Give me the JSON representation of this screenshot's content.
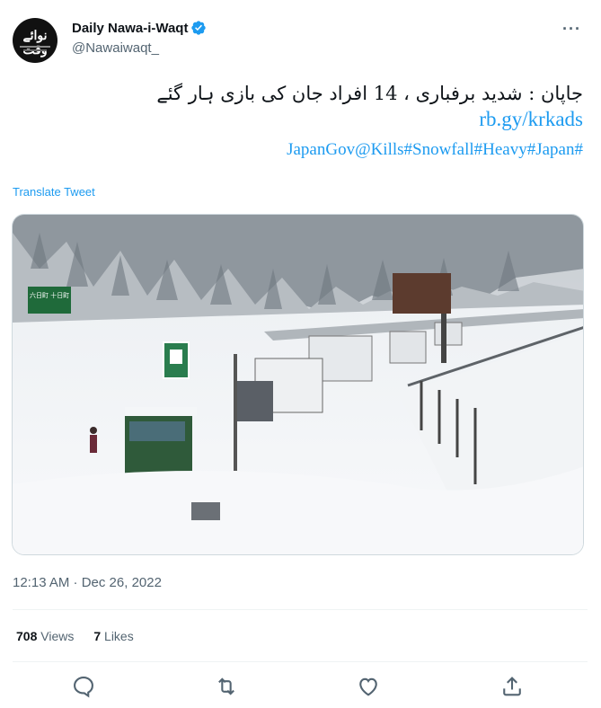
{
  "account": {
    "display_name": "Daily Nawa-i-Waqt",
    "handle": "@Nawaiwaqt_",
    "avatar_text": "نوائے وقت",
    "verified_icon": "verified-badge-icon",
    "verified_color": "#1d9bf0"
  },
  "tweet": {
    "urdu_text": "جاپان : شدید برفباری ، 14 افراد جان کی بازی ہار گئے",
    "link": "rb.gy/krkads",
    "hashtags": "JapanGov@Kills#Snowfall#Heavy#Japan#"
  },
  "translate_label": "Translate Tweet",
  "media": {
    "sign_text": "六日町 十日町"
  },
  "timestamp": "12:13 AM · Dec 26, 2022",
  "stats": {
    "views_count": "708",
    "views_label": "Views",
    "likes_count": "7",
    "likes_label": "Likes"
  },
  "icons": {
    "more": "more-options-icon",
    "reply": "reply-icon",
    "retweet": "retweet-icon",
    "like": "like-icon",
    "share": "share-icon"
  },
  "colors": {
    "accent": "#1d9bf0",
    "muted": "#536471",
    "text": "#0f1419"
  }
}
